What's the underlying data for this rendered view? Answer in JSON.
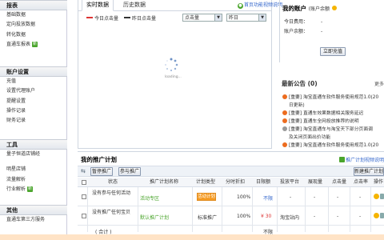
{
  "sidebar": {
    "sections": [
      {
        "title": "报表",
        "items": [
          {
            "label": "基础数据"
          },
          {
            "label": "定向投放数据"
          },
          {
            "label": "转化数据"
          },
          {
            "label": "直通车报表",
            "tag": "新"
          }
        ]
      },
      {
        "title": "账户设置",
        "items": [
          {
            "label": "充值"
          },
          {
            "label": "设置代理账户"
          },
          {
            "label": "提醒设置"
          },
          {
            "label": "操作记录"
          },
          {
            "label": "财务记录"
          }
        ]
      },
      {
        "title": "工具",
        "items": [
          {
            "label": "量子恒道店铺经"
          },
          {
            "label": "明星店铺"
          },
          {
            "label": "流量解析"
          },
          {
            "label": "行业解析",
            "tag": "新"
          }
        ]
      },
      {
        "title": "其他",
        "items": [
          {
            "label": "直通车第三方服务"
          }
        ]
      }
    ]
  },
  "realtime": {
    "tabs": [
      {
        "label": "实时数据",
        "active": true
      },
      {
        "label": "历史数据",
        "active": false
      }
    ],
    "help_link": "首页功能视频说明",
    "legend_today": "今日点击量",
    "legend_yesterday": "昨日点击量",
    "legend_today_color": "#d33",
    "legend_yesterday_color": "#333",
    "metric_select": "点击量",
    "day_select": "昨日",
    "loading_text": "loading..."
  },
  "account": {
    "title": "我的账户",
    "subtitle": "(账户余额",
    "today_cost_label": "今日费用：",
    "today_cost_value": "-",
    "balance_label": "账户余额：",
    "balance_value": "-",
    "recharge_button": "立即充值"
  },
  "notice": {
    "title": "最新公告",
    "count": "(0)",
    "more": "更多",
    "items": [
      {
        "text": "[重要] 淘宝直通车软件服务使用规范1.0(20",
        "icon": "orange"
      },
      {
        "text": "日更新)",
        "icon": "none"
      },
      {
        "text": "[重要] 直通车效果数据相关服务延迟",
        "icon": "orange"
      },
      {
        "text": "[重要] 直通车全网投放推荐的说明",
        "icon": "orange"
      },
      {
        "text": "[重要] 淘宝直通车与淘宝天下部分页面调",
        "icon": "gray"
      },
      {
        "text": "及关闭页面出价功能",
        "icon": "none"
      },
      {
        "text": "[重要] 淘宝直通车软件服务使用规范1.0(20",
        "icon": "orange"
      }
    ]
  },
  "plan": {
    "title": "我的推广计划",
    "help_link": "推广计划视频说明",
    "pause_button": "暂停推广",
    "start_button": "参与推广",
    "new_button": "新建推广计划",
    "columns": [
      "状态",
      "推广计划名称",
      "计划类型",
      "分时折扣",
      "日限额",
      "投放平台",
      "展现量",
      "点击量",
      "点击率",
      "操作"
    ],
    "rows": [
      {
        "status": "没有参与任何活动",
        "name": "活动专区",
        "type": "活动计划",
        "discount": "100%",
        "limit": "不限",
        "platform": "-",
        "impressions": "-",
        "clicks": "-",
        "ctr": "-"
      },
      {
        "status": "没有推广任何宝贝",
        "name": "默认推广计划",
        "type": "标准推广",
        "discount": "100%",
        "limit": "¥ 30",
        "platform": "淘宝站内",
        "impressions": "-",
        "clicks": "-",
        "ctr": "-"
      }
    ],
    "total_label": "( 合计 )",
    "total_limit": "不限"
  },
  "colors": {
    "accent_green": "#4aa52c",
    "accent_orange": "#f59b24",
    "link_blue": "#36c"
  }
}
